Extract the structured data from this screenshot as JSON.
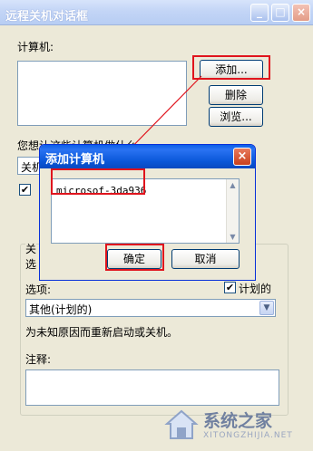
{
  "outer_dialog": {
    "title": "远程关机对话框",
    "computers_label": "计算机:",
    "add_label": "添加...",
    "delete_label": "删除",
    "browse_label": "浏览...",
    "question_partial": "您想让这些计算机做什么",
    "select_partial": "关机",
    "group_partial": "关",
    "instruction_partial": "选",
    "options_label": "选项:",
    "planned_label": "计划的",
    "planned_checked": true,
    "option_value": "其他(计划的)",
    "reason_text": "为未知原因而重新启动或关机。",
    "comment_label": "注释:"
  },
  "inner_dialog": {
    "title": "添加计算机",
    "computer_name": "microsof-3da936",
    "ok_label": "确定",
    "cancel_label": "取消"
  },
  "watermark": {
    "text": "系统之家",
    "sub": "XITONGZHIJIA.NET"
  },
  "colors": {
    "highlight": "#e0141d",
    "xp_blue": "#0a57d8"
  }
}
